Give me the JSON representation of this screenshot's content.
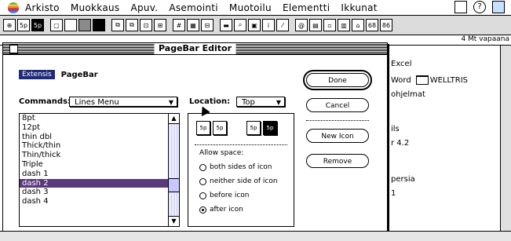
{
  "menubar": {
    "items": [
      "Arkisto",
      "Muokkaus",
      "Apuv.",
      "Asemointi",
      "Muotoilu",
      "Elementti",
      "Ikkunat"
    ],
    "right_icons": [
      "window-icon",
      "help-icon",
      "finder-icon"
    ]
  },
  "toolbar": {
    "icons": [
      "cursor-tool-icon",
      "5p-icon",
      "5p-icon",
      "frame-icon",
      "empty-rect-icon",
      "grey-rect-icon",
      "black-rect-icon",
      "copy-icon",
      "paste-icon",
      "zoom-icon",
      "grid-icon",
      "pattern-icon",
      "frame2-icon",
      "bar-icon",
      "search-icon",
      "numbering-icon",
      "i-icon",
      "pen-icon",
      "spiral-icon",
      "image-icon",
      "square-icon",
      "image2-icon",
      "brush-icon",
      "68-icon",
      "86-icon"
    ],
    "labels": {
      "p5a": "5p",
      "p5b": "5p",
      "n68": "68",
      "n86": "86"
    }
  },
  "back_window": {
    "free_space": "4 Mt vapaana",
    "lines": [
      "Excel",
      "Word",
      "WELLTRIS",
      "ohjelmat",
      "ils",
      "r 4.2",
      "persia",
      "1"
    ]
  },
  "dialog": {
    "title": "PageBar Editor",
    "logo": "Extensis",
    "product": "PageBar",
    "commands_label": "Commands:",
    "commands_value": "Lines Menu",
    "location_label": "Location:",
    "location_value": "Top",
    "list_items": [
      "8pt",
      "12pt",
      "thin dbl",
      "Thick/thin",
      "Thin/thick",
      "Triple",
      "dash 1",
      "dash 2",
      "dash 3",
      "dash 4"
    ],
    "selected_item": "dash 2",
    "icon_labels": [
      "5p",
      "5p",
      "5p",
      "5p"
    ],
    "allow_space_label": "Allow space:",
    "radio_options": [
      "both sides of icon",
      "neither side of icon",
      "before icon",
      "after icon"
    ],
    "radio_selected": "after icon",
    "buttons": {
      "done": "Done",
      "cancel": "Cancel",
      "new_icon": "New Icon",
      "remove": "Remove"
    }
  },
  "colors": {
    "selection": "#5a3a7a",
    "logo_bg": "#1f2b7a",
    "scroll_pattern": "#c8c8ff"
  }
}
